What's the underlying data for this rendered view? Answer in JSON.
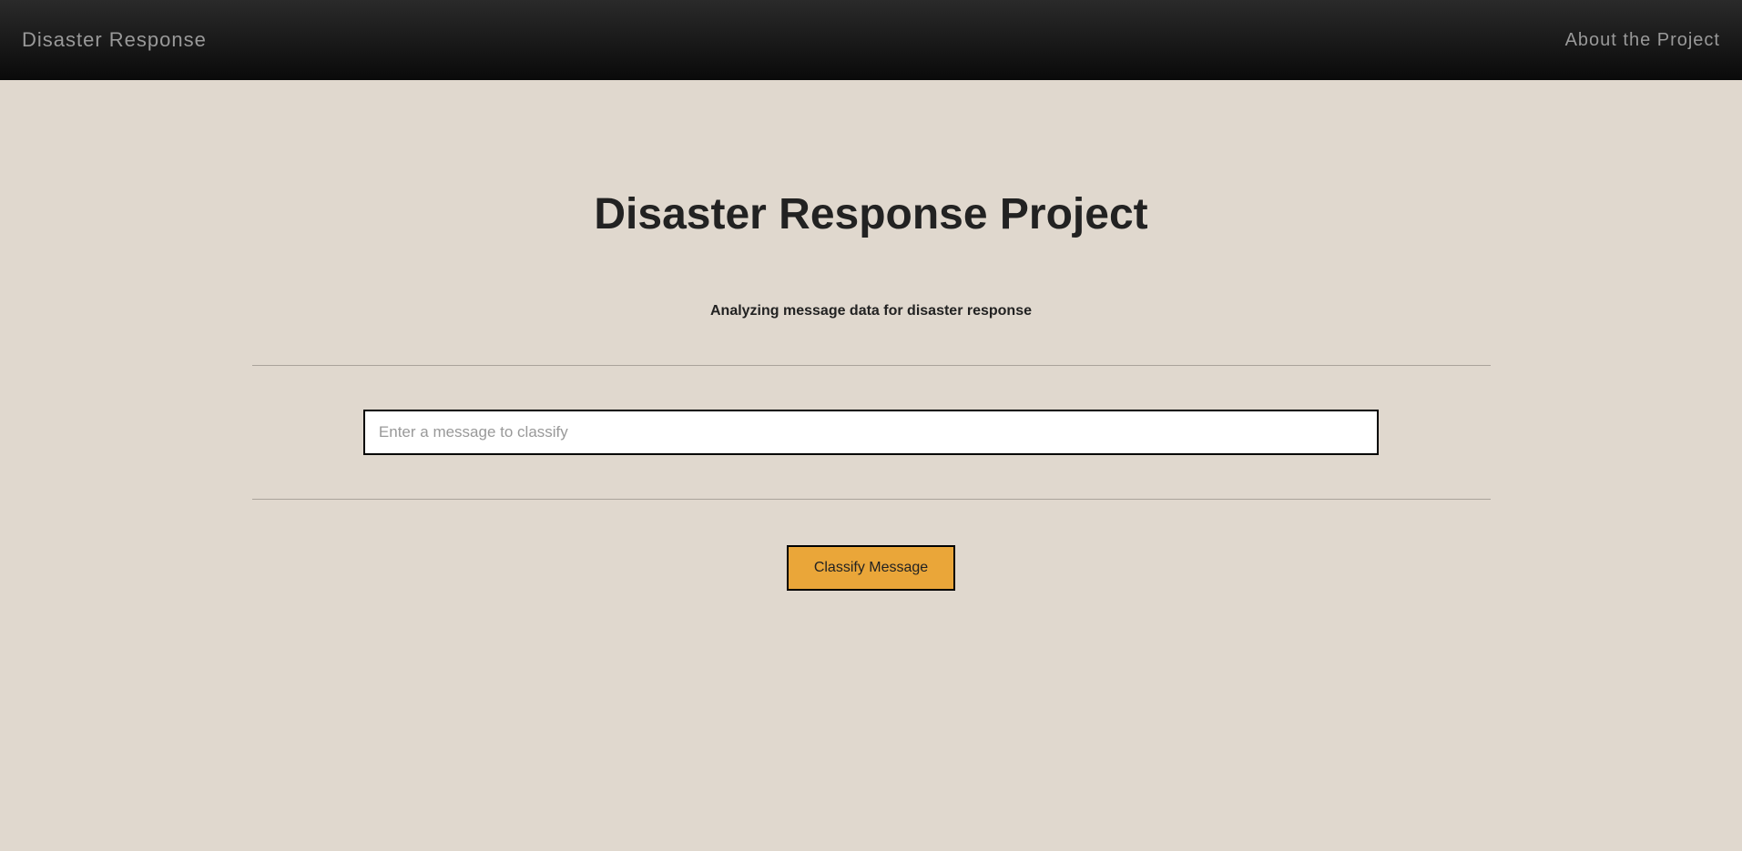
{
  "navbar": {
    "brand": "Disaster Response",
    "about_link": "About the Project"
  },
  "main": {
    "title": "Disaster Response Project",
    "subtitle": "Analyzing message data for disaster response",
    "input_placeholder": "Enter a message to classify",
    "button_label": "Classify Message"
  }
}
